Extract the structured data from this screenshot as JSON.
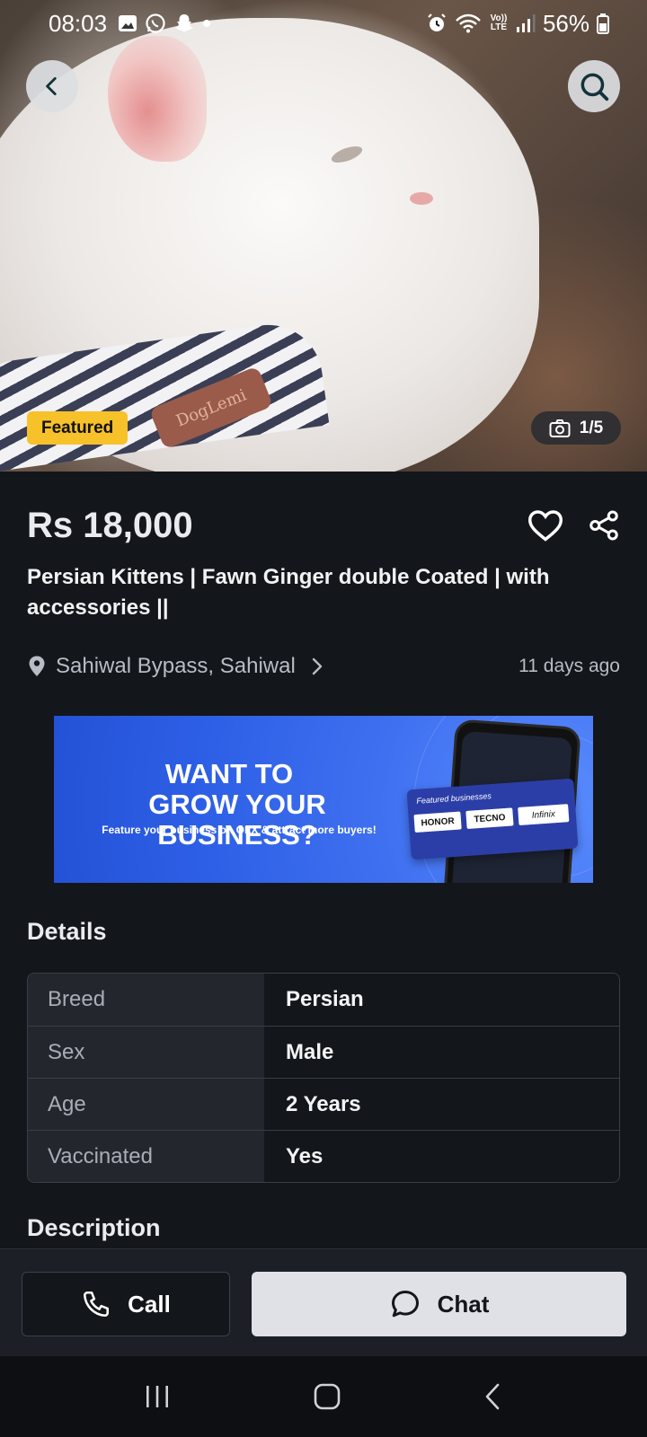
{
  "status_bar": {
    "time": "08:03",
    "battery": "56%",
    "network_label": "Vo)) LTE"
  },
  "gallery": {
    "badge": "Featured",
    "counter": "1/5",
    "collar_text": "DogLemi"
  },
  "listing": {
    "price": "Rs 18,000",
    "title": "Persian Kittens | Fawn Ginger double Coated | with accessories ||",
    "location": "Sahiwal Bypass, Sahiwal",
    "posted": "11 days ago"
  },
  "banner": {
    "line1": "WANT TO",
    "line2": "GROW YOUR BUSINESS?",
    "subtitle": "Feature your business on OLX & attract more buyers!",
    "card_title": "Featured businesses",
    "brands": [
      "HONOR",
      "TECNO",
      "Infinix"
    ]
  },
  "details": {
    "title": "Details",
    "rows": [
      {
        "key": "Breed",
        "value": "Persian"
      },
      {
        "key": "Sex",
        "value": "Male"
      },
      {
        "key": "Age",
        "value": "2 Years"
      },
      {
        "key": "Vaccinated",
        "value": "Yes"
      }
    ]
  },
  "description": {
    "title": "Description"
  },
  "actions": {
    "call_label": "Call",
    "chat_label": "Chat"
  },
  "icons": {
    "back": "chevron-left-icon",
    "search": "search-icon",
    "camera": "camera-icon",
    "favorite": "heart-icon",
    "share": "share-icon",
    "location": "location-pin-icon",
    "call": "phone-icon",
    "chat": "chat-bubble-icon"
  },
  "colors": {
    "background": "#13161b",
    "featured_badge": "#f7c12a",
    "banner_blue": "#2d5fe6",
    "chat_button": "#dfe1e6"
  }
}
